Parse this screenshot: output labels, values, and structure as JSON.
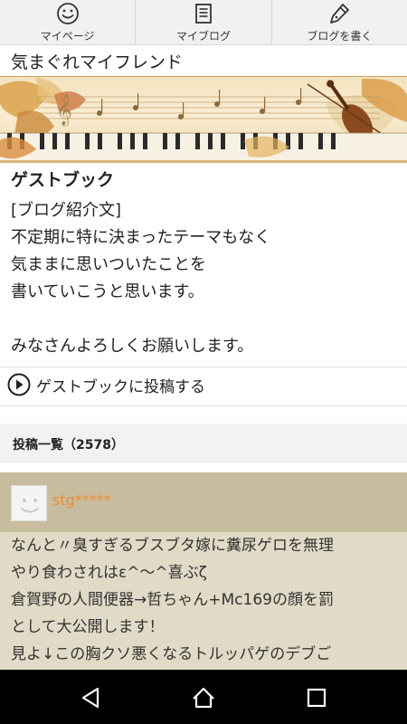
{
  "nav": {
    "items": [
      {
        "label": "マイページ",
        "icon": "smiley-face-icon"
      },
      {
        "label": "マイブログ",
        "icon": "document-icon"
      },
      {
        "label": "ブログを書く",
        "icon": "pen-icon"
      }
    ]
  },
  "blog": {
    "title": "気まぐれマイフレンド"
  },
  "guestbook": {
    "heading": "ゲストブック",
    "intro_lines": [
      "[ブログ紹介文]",
      "不定期に特に決まったテーマもなく",
      "気ままに思いついたことを",
      "書いていこうと思います。",
      "",
      "みなさんよろしくお願いします。"
    ],
    "post_link": "ゲストブックに投稿する",
    "list_header": "投稿一覧（2578）"
  },
  "entry": {
    "username": "stg*****",
    "lines": [
      "なんと〃臭すぎるブスブタ嫁に糞尿ゲロを無理",
      "やり食わされはε^〜^喜ぶζ",
      "倉賀野の人間便器→哲ちゃん+Mc169の顔を罰",
      "として大公開します！",
      "見よ↓この胸クソ悪くなるトルッパゲのデブご"
    ]
  },
  "colors": {
    "nav_bg": "#f1f1f1",
    "entry_head_bg": "#c8bc9f",
    "entry_body_bg": "#e1dac6",
    "username_color": "#f08a32",
    "list_header_bg": "#f2f2f2"
  },
  "system_nav": [
    "back-icon",
    "home-icon",
    "recents-icon"
  ]
}
